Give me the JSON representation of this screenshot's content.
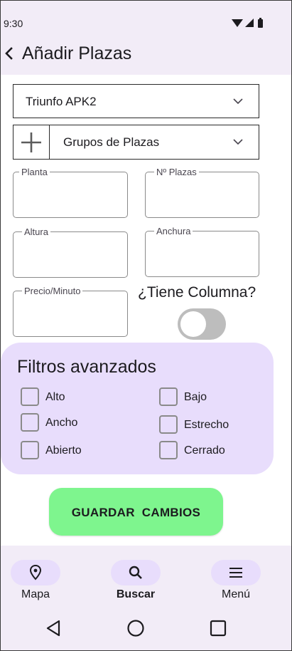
{
  "status_bar": {
    "time": "9:30"
  },
  "app_bar": {
    "title": "Añadir Plazas",
    "back_icon": "chevron-left-icon"
  },
  "parking_select": {
    "value": "Triunfo APK2"
  },
  "group_select": {
    "value": "Grupos de Plazas"
  },
  "fields": {
    "planta": {
      "label": "Planta",
      "value": ""
    },
    "num_plazas": {
      "label": "Nº Plazas",
      "value": ""
    },
    "altura": {
      "label": "Altura",
      "value": ""
    },
    "anchura": {
      "label": "Anchura",
      "value": ""
    },
    "precio_minuto": {
      "label": "Precio/Minuto",
      "value": ""
    }
  },
  "column_toggle": {
    "label": "¿Tiene Columna?",
    "on": false
  },
  "filters": {
    "title": "Filtros avanzados",
    "options": [
      {
        "label": "Alto",
        "checked": false
      },
      {
        "label": "Bajo",
        "checked": false
      },
      {
        "label": "Ancho",
        "checked": false
      },
      {
        "label": "Estrecho",
        "checked": false
      },
      {
        "label": "Abierto",
        "checked": false
      },
      {
        "label": "Cerrado",
        "checked": false
      }
    ]
  },
  "save_button": {
    "label": "GUARDAR  CAMBIOS"
  },
  "bottom_nav": {
    "items": [
      {
        "label": "Mapa",
        "icon": "location-pin-icon"
      },
      {
        "label": "Buscar",
        "icon": "search-icon",
        "selected": true
      },
      {
        "label": "Menú",
        "icon": "hamburger-menu-icon"
      }
    ]
  },
  "colors": {
    "surface": "#f2ecf7",
    "filters_panel": "#e8ddfc",
    "save_button": "#7ef58e",
    "toggle_off": "#bdbdbd"
  }
}
